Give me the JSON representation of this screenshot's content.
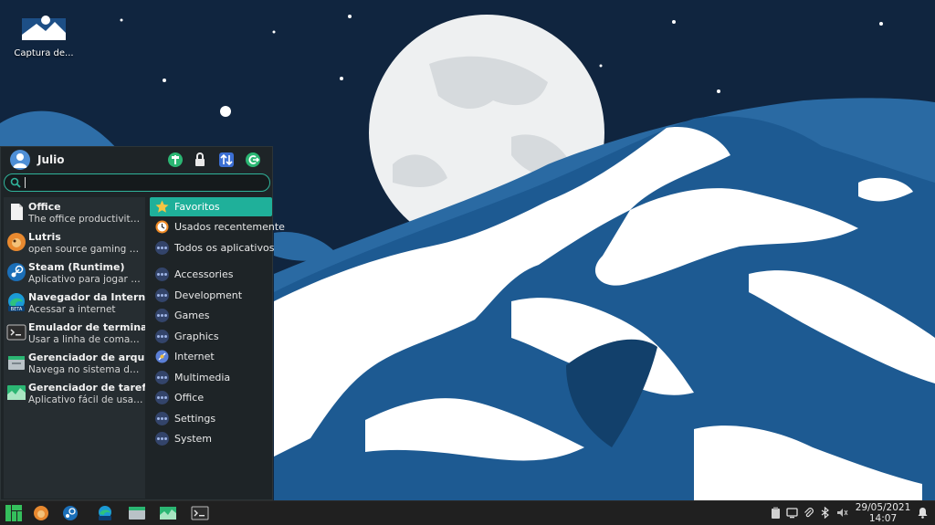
{
  "desktop": {
    "icons": [
      {
        "label": "Captura de...",
        "icon": "image-thumbnail-icon"
      }
    ]
  },
  "menu": {
    "username": "Julio",
    "header_buttons": [
      "settings-icon",
      "lock-icon",
      "switch-user-icon",
      "logout-icon"
    ],
    "search": {
      "value": "",
      "placeholder": ""
    },
    "favorites": [
      {
        "name": "Office",
        "desc": "The office productivity su...",
        "icon": "office-icon"
      },
      {
        "name": "Lutris",
        "desc": "open source gaming platf...",
        "icon": "lutris-icon"
      },
      {
        "name": "Steam (Runtime)",
        "desc": "Aplicativo para jogar e ge...",
        "icon": "steam-icon"
      },
      {
        "name": "Navegador da Internet",
        "desc": "Acessar a internet",
        "icon": "edge-beta-icon"
      },
      {
        "name": "Emulador de terminal",
        "desc": "Usar a linha de comando",
        "icon": "terminal-icon"
      },
      {
        "name": "Gerenciador de arquivos",
        "desc": "Navega no sistema de ar...",
        "icon": "file-manager-icon"
      },
      {
        "name": "Gerenciador de tarefas",
        "desc": "Aplicativo fácil de usar pa...",
        "icon": "task-manager-icon"
      }
    ],
    "categories_top": [
      {
        "label": "Favoritos",
        "icon": "star-icon",
        "active": true
      },
      {
        "label": "Usados recentemente",
        "icon": "clock-icon"
      },
      {
        "label": "Todos os aplicativos",
        "icon": "apps-icon"
      }
    ],
    "categories": [
      {
        "label": "Accessories",
        "icon": "category-icon"
      },
      {
        "label": "Development",
        "icon": "category-icon"
      },
      {
        "label": "Games",
        "icon": "category-icon"
      },
      {
        "label": "Graphics",
        "icon": "category-icon"
      },
      {
        "label": "Internet",
        "icon": "internet-icon"
      },
      {
        "label": "Multimedia",
        "icon": "category-icon"
      },
      {
        "label": "Office",
        "icon": "category-icon"
      },
      {
        "label": "Settings",
        "icon": "category-icon"
      },
      {
        "label": "System",
        "icon": "category-icon"
      }
    ]
  },
  "taskbar": {
    "apps": [
      "manjaro-menu-icon",
      "lutris-icon",
      "steam-icon",
      "edge-beta-icon",
      "file-manager-icon",
      "task-manager-icon",
      "terminal-icon"
    ],
    "tray": [
      "clipboard-icon",
      "display-icon",
      "paperclip-icon",
      "bluetooth-icon",
      "volume-muted-icon",
      "notifications-icon"
    ],
    "date": "29/05/2021",
    "time": "14:07"
  },
  "colors": {
    "accent": "#1fb09a",
    "menu_bg": "#1e2427",
    "panel_bg": "#202020",
    "sky": "#0f2540"
  }
}
